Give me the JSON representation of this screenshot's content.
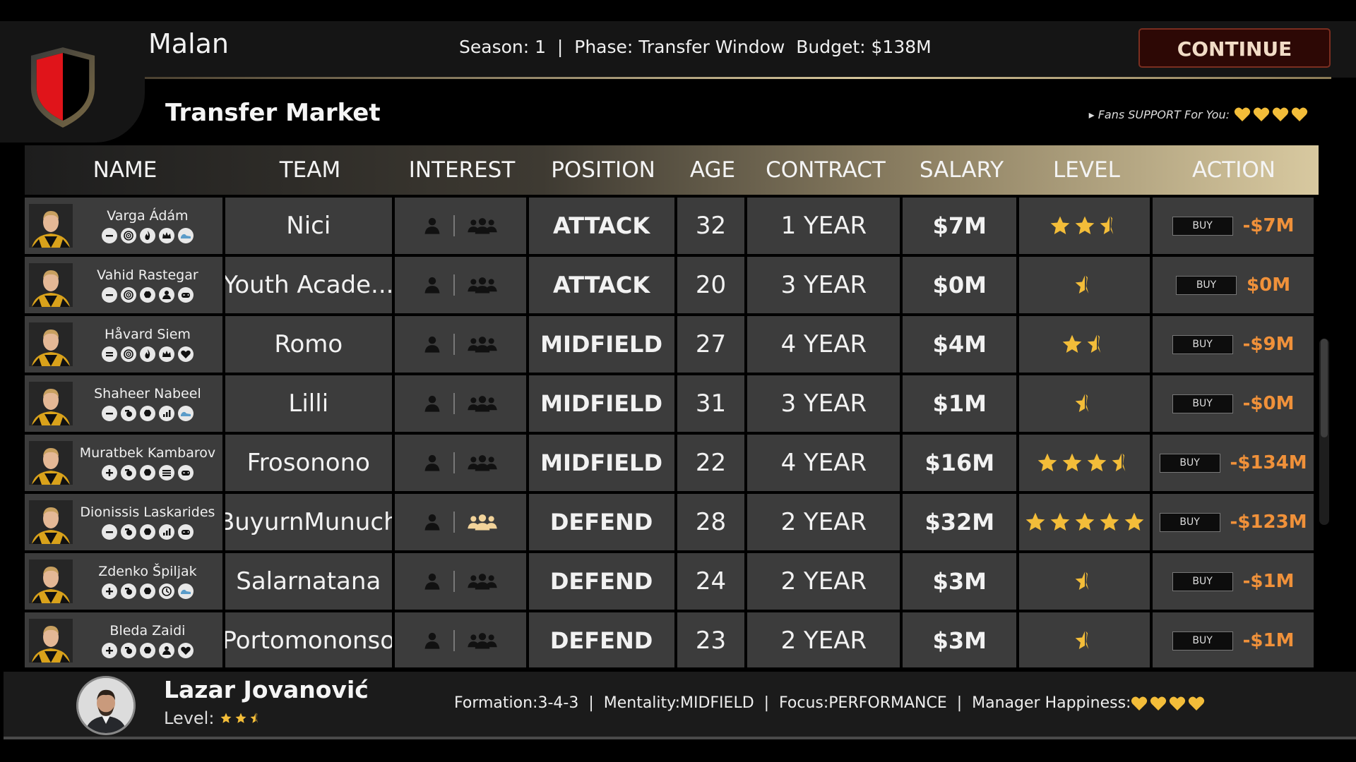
{
  "header": {
    "team_name": "Malan",
    "season_label": "Season:",
    "season": "1",
    "phase_label": "Phase:",
    "phase": "Transfer Window",
    "budget_label": "Budget:",
    "budget": "$138M",
    "continue_label": "CONTINUE",
    "section_title": "Transfer Market",
    "fans_label": "▸ Fans SUPPORT For You:",
    "fans_support_hearts": 4
  },
  "colors": {
    "accent_gold": "#f3bd39",
    "cost_orange": "#f0913a",
    "crest_red": "#e0141a",
    "crest_black": "#000000",
    "continue_bg": "#2d0805"
  },
  "table": {
    "columns": [
      "NAME",
      "TEAM",
      "INTEREST",
      "POSITION",
      "AGE",
      "CONTRACT",
      "SALARY",
      "LEVEL",
      "ACTION"
    ],
    "buy_label": "BUY",
    "rows": [
      {
        "name": "Varga Ádám",
        "traits": [
          "minus",
          "target",
          "fire",
          "crown",
          "shoe"
        ],
        "team": "Nici",
        "interest_team": false,
        "position": "ATTACK",
        "age": "32",
        "contract": "1 YEAR",
        "salary": "$7M",
        "stars": 2.5,
        "cost": "-$7M"
      },
      {
        "name": "Vahid Rastegar",
        "traits": [
          "minus",
          "target",
          "brain",
          "person",
          "gamepad"
        ],
        "team": "Youth Acade...",
        "interest_team": false,
        "position": "ATTACK",
        "age": "20",
        "contract": "3 YEAR",
        "salary": "$0M",
        "stars": 0.5,
        "cost": "$0M"
      },
      {
        "name": "Håvard Siem",
        "traits": [
          "equals",
          "target",
          "fire",
          "crown",
          "heart"
        ],
        "team": "Romo",
        "interest_team": false,
        "position": "MIDFIELD",
        "age": "27",
        "contract": "4 YEAR",
        "salary": "$4M",
        "stars": 1.5,
        "cost": "-$9M"
      },
      {
        "name": "Shaheer Nabeel",
        "traits": [
          "minus",
          "whistle",
          "brain",
          "chart",
          "shoe"
        ],
        "team": "Lilli",
        "interest_team": false,
        "position": "MIDFIELD",
        "age": "31",
        "contract": "3 YEAR",
        "salary": "$1M",
        "stars": 0.5,
        "cost": "-$0M"
      },
      {
        "name": "Muratbek Kambarov",
        "traits": [
          "plus",
          "whistle",
          "brain",
          "bars",
          "gamepad"
        ],
        "team": "Frosonono",
        "interest_team": false,
        "position": "MIDFIELD",
        "age": "22",
        "contract": "4 YEAR",
        "salary": "$16M",
        "stars": 3.5,
        "cost": "-$134M"
      },
      {
        "name": "Dionissis Laskarides",
        "traits": [
          "minus",
          "whistle",
          "brain",
          "chart",
          "gamepad"
        ],
        "team": "BuyurnMunuch",
        "interest_team": true,
        "position": "DEFEND",
        "age": "28",
        "contract": "2 YEAR",
        "salary": "$32M",
        "stars": 5,
        "cost": "-$123M"
      },
      {
        "name": "Zdenko Špiljak",
        "traits": [
          "plus",
          "whistle",
          "brain",
          "clock",
          "shoe"
        ],
        "team": "Salarnatana",
        "interest_team": false,
        "position": "DEFEND",
        "age": "24",
        "contract": "2 YEAR",
        "salary": "$3M",
        "stars": 0.5,
        "cost": "-$1M"
      },
      {
        "name": "Bleda Zaidi",
        "traits": [
          "plus",
          "whistle",
          "brain",
          "person",
          "heart"
        ],
        "team": "Portomononso",
        "interest_team": false,
        "position": "DEFEND",
        "age": "23",
        "contract": "2 YEAR",
        "salary": "$3M",
        "stars": 0.5,
        "cost": "-$1M"
      }
    ]
  },
  "manager": {
    "name": "Lazar Jovanović",
    "level_label": "Level:",
    "stars": 2.5,
    "formation_label": "Formation:",
    "formation": "3-4-3",
    "mentality_label": "Mentality:",
    "mentality": "MIDFIELD",
    "focus_label": "Focus:",
    "focus": "PERFORMANCE",
    "happiness_label": "Manager Happiness:",
    "happiness_hearts": 4
  }
}
